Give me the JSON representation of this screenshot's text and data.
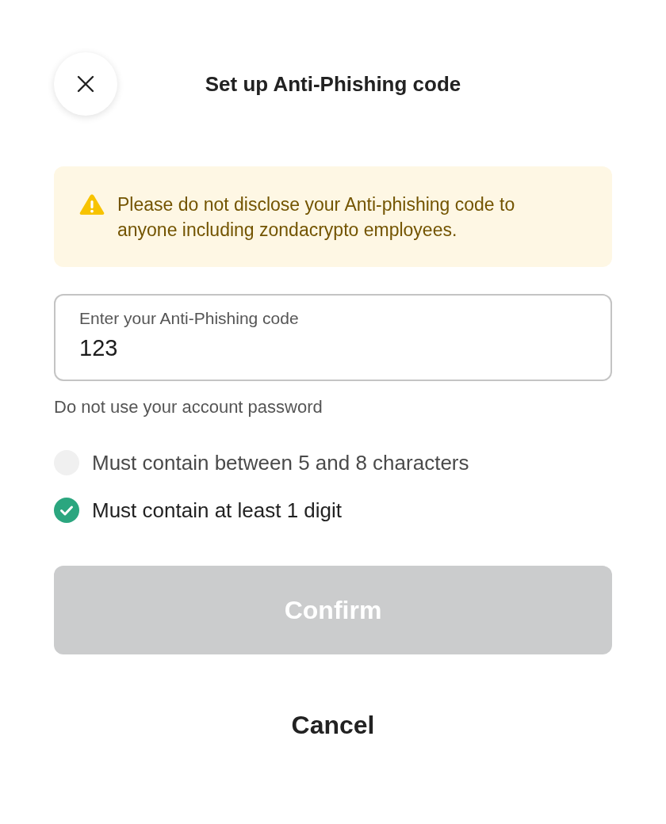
{
  "header": {
    "title": "Set up Anti-Phishing code"
  },
  "warning": {
    "text": "Please do not disclose your Anti-phishing code to anyone including zondacrypto employees."
  },
  "code_field": {
    "label": "Enter your Anti-Phishing code",
    "value": "123",
    "helper": "Do not use your account password"
  },
  "requirements": [
    {
      "text": "Must contain between 5 and 8 characters",
      "checked": false
    },
    {
      "text": "Must contain at least 1 digit",
      "checked": true
    }
  ],
  "confirm_button": {
    "label": "Confirm",
    "disabled": true
  },
  "cancel_button": {
    "label": "Cancel"
  }
}
